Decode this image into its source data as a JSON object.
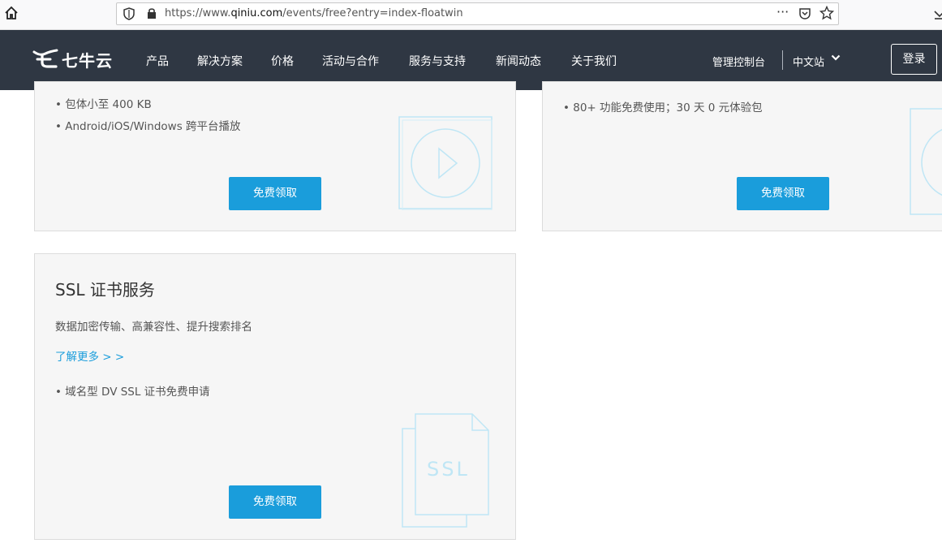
{
  "browser": {
    "url_prefix": "https://www.",
    "url_domain": "qiniu.com",
    "url_path": "/events/free?entry=index-floatwin",
    "more_label": "···"
  },
  "nav": {
    "logo_text": "七牛云",
    "items": [
      "产品",
      "解决方案",
      "价格",
      "活动与合作",
      "服务与支持",
      "新闻动态",
      "关于我们"
    ],
    "console": "管理控制台",
    "site": "中文站",
    "login": "登录"
  },
  "cards": [
    {
      "bullets": [
        "• 包体小至 400 KB",
        "• Android/iOS/Windows 跨平台播放"
      ],
      "button": "免费领取",
      "icon": "play-icon"
    },
    {
      "bullets": [
        "• 80+ 功能免费使用；30 天 0 元体验包"
      ],
      "button": "免费领取",
      "icon": "circle-icon"
    },
    {
      "title": "SSL 证书服务",
      "desc": "数据加密传输、高兼容性、提升搜索排名",
      "more": "了解更多 > >",
      "bullets": [
        "• 域名型 DV SSL 证书免费申请"
      ],
      "button": "免费领取",
      "icon": "ssl-document-icon",
      "icon_text": "SSL"
    }
  ],
  "colors": {
    "nav_bg": "#2f3743",
    "accent": "#1a9ddb",
    "card_bg": "#f6f6f6",
    "deco": "#bfe6f5"
  }
}
